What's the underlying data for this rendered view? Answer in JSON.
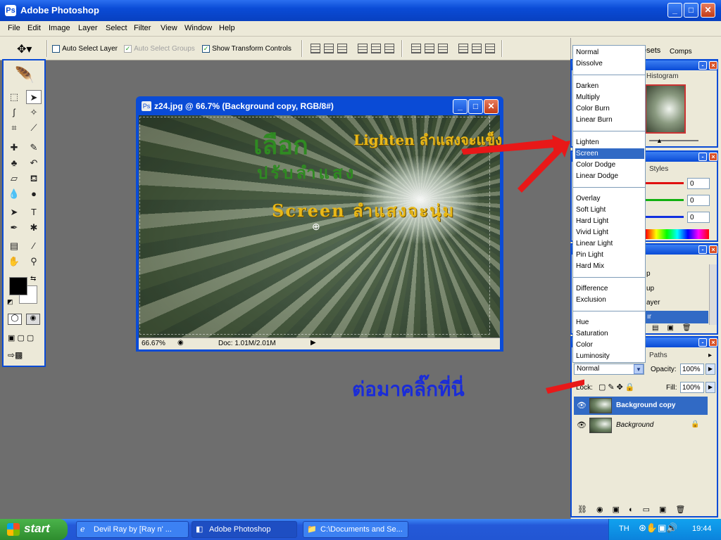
{
  "window": {
    "title": "Adobe Photoshop"
  },
  "menu": [
    "File",
    "Edit",
    "Image",
    "Layer",
    "Select",
    "Filter",
    "View",
    "Window",
    "Help"
  ],
  "options": {
    "auto_select_layer": "Auto Select Layer",
    "auto_select_groups": "Auto Select Groups",
    "show_transform_controls": "Show Transform Controls"
  },
  "document": {
    "title": "z24.jpg @ 66.7% (Background copy, RGB/8#)",
    "zoom": "66.67%",
    "doc_size": "Doc: 1.01M/2.01M",
    "overlay_text": {
      "select": "เลือก",
      "adjust_light": "ปรับลำแสง",
      "lighten": "Lighten ลำแสงจะแข็ง",
      "screen": "Screen ลำแสงจะนุ่ม",
      "next_click": "ต่อมาคลิ๊กที่นี่"
    }
  },
  "panels": {
    "tabs_top": [
      "esets",
      "Comps"
    ],
    "histogram_tab": "Histogram",
    "styles_tab": "Styles",
    "color_values": [
      "0",
      "0",
      "0"
    ],
    "actions_partial": [
      "p",
      "up",
      "ayer",
      "ır"
    ],
    "paths_tab": "Paths",
    "opacity_label": "Opacity:",
    "opacity_value": "100%",
    "lock_label": "Lock:",
    "fill_label": "Fill:",
    "fill_value": "100%",
    "blend_mode": "Normal"
  },
  "blend_modes": {
    "group1": [
      "Normal",
      "Dissolve"
    ],
    "group2": [
      "Darken",
      "Multiply",
      "Color Burn",
      "Linear Burn"
    ],
    "group3": [
      "Lighten",
      "Screen",
      "Color Dodge",
      "Linear Dodge"
    ],
    "group4": [
      "Overlay",
      "Soft Light",
      "Hard Light",
      "Vivid Light",
      "Linear Light",
      "Pin Light",
      "Hard Mix"
    ],
    "group5": [
      "Difference",
      "Exclusion"
    ],
    "group6": [
      "Hue",
      "Saturation",
      "Color",
      "Luminosity"
    ],
    "selected": "Screen"
  },
  "layers": [
    {
      "name": "Background copy",
      "selected": true
    },
    {
      "name": "Background",
      "selected": false
    }
  ],
  "taskbar": {
    "start": "start",
    "items": [
      "Devil Ray by [Ray n' ...",
      "Adobe Photoshop",
      "C:\\Documents and Se..."
    ],
    "lang": "TH",
    "clock": "19:44"
  }
}
